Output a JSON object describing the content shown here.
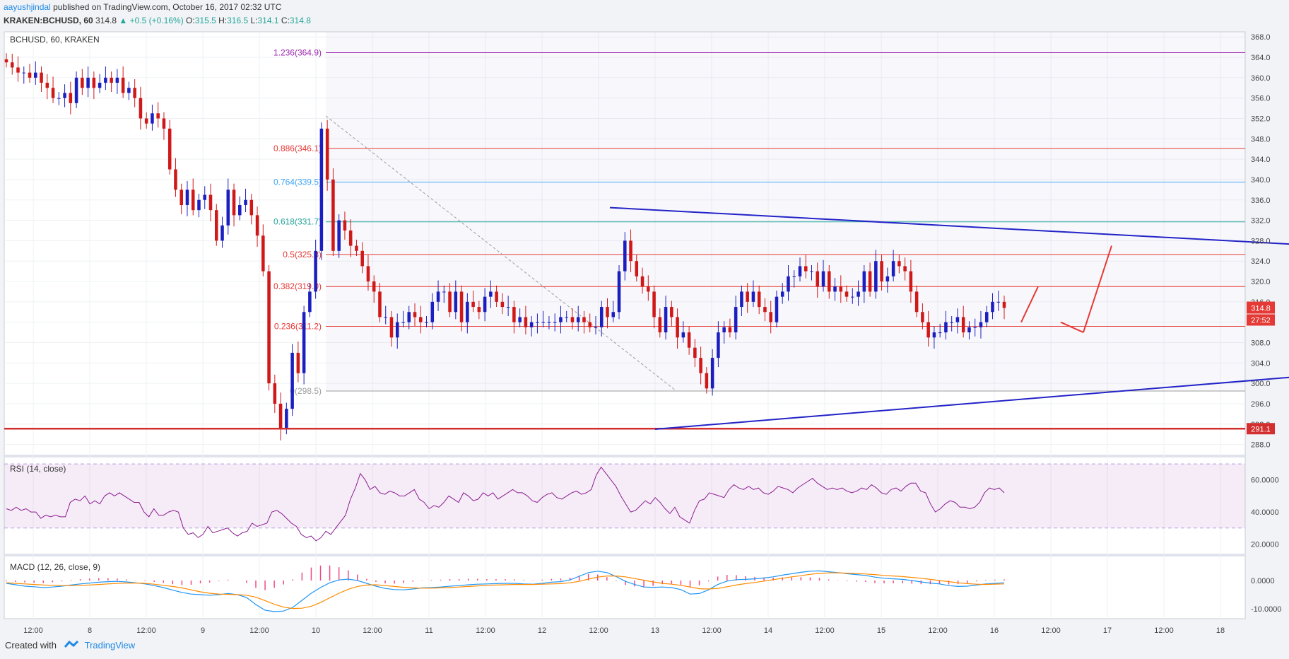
{
  "header": {
    "publisher": "aayushjindal",
    "published_text": "published on TradingView.com, October 16, 2017 02:32 UTC",
    "symbol": "KRAKEN:BCHUSD, 60",
    "last": "314.8",
    "change": "+0.5 (+0.16%)",
    "open_label": "O:",
    "open": "315.5",
    "high_label": "H:",
    "high": "316.5",
    "low_label": "L:",
    "low": "314.1",
    "close_label": "C:",
    "close": "314.8"
  },
  "footer": {
    "created_with": "Created with",
    "brand": "TradingView"
  },
  "colors": {
    "up": "#1c1fbf",
    "down": "#d01818",
    "trendline": "#2323c8",
    "rsi": "#8a1d8f",
    "macd": "#2196f3",
    "signal": "#ff8a00",
    "support": "#d32f2f"
  },
  "chart_data": [
    {
      "type": "candlestick",
      "title": "BCHUSD, 60, KRAKEN",
      "ylim": [
        286.0,
        369.0
      ],
      "y_ticks": [
        "368.0",
        "364.0",
        "360.0",
        "356.0",
        "352.0",
        "348.0",
        "344.0",
        "340.0",
        "336.0",
        "332.0",
        "328.0",
        "324.0",
        "320.0",
        "316.0",
        "312.0",
        "308.0",
        "304.0",
        "300.0",
        "296.0",
        "292.0",
        "288.0"
      ],
      "x_ticks": [
        "12:00",
        "8",
        "12:00",
        "9",
        "12:00",
        "10",
        "12:00",
        "11",
        "12:00",
        "12",
        "12:00",
        "13",
        "12:00",
        "14",
        "12:00",
        "15",
        "12:00",
        "16",
        "12:00",
        "17",
        "12:00",
        "18"
      ],
      "closes": [
        363,
        362,
        361,
        361,
        360,
        361,
        359,
        358,
        356,
        356,
        357,
        355,
        360,
        358,
        360,
        358,
        359,
        360,
        359,
        360,
        357,
        358,
        356,
        352,
        351,
        353,
        352,
        350,
        342,
        338,
        335,
        338,
        334,
        336,
        337,
        334,
        328,
        331,
        338,
        333,
        335,
        336,
        333,
        329,
        322,
        300,
        296,
        291,
        295,
        306,
        302,
        314,
        318,
        326,
        350,
        340,
        326,
        332,
        330,
        327,
        326,
        323,
        320,
        318,
        313,
        313,
        309,
        312,
        312,
        314,
        313,
        312,
        312,
        316,
        318,
        318,
        314,
        318,
        312,
        316,
        315,
        314,
        317,
        318,
        316,
        315,
        315,
        312,
        313,
        311,
        312,
        312,
        312,
        312,
        312,
        313,
        313,
        312,
        313,
        312,
        311,
        311,
        315,
        313,
        314,
        322,
        328,
        324,
        321,
        319,
        318,
        313,
        310,
        315,
        313,
        309,
        310,
        307,
        305,
        302,
        299,
        305,
        310,
        311,
        310,
        315,
        318,
        316,
        318,
        315,
        314,
        312,
        317,
        318,
        321,
        321,
        323,
        322,
        322,
        319,
        322,
        318,
        319,
        318,
        317,
        317,
        318,
        322,
        318,
        324,
        320,
        321,
        324,
        323,
        322,
        318,
        314,
        312,
        309,
        310,
        310,
        312,
        312,
        313,
        310,
        311,
        311,
        312,
        314,
        316,
        316,
        314.8
      ],
      "level_lines": [
        {
          "label": "1.236(364.9)",
          "value": 364.9,
          "color": "#9c27b0"
        },
        {
          "label": "0.886(346.1)",
          "value": 346.1,
          "color": "#e53935"
        },
        {
          "label": "0.764(339.5)",
          "value": 339.5,
          "color": "#42a5f5"
        },
        {
          "label": "0.618(331.7)",
          "value": 331.7,
          "color": "#26a69a"
        },
        {
          "label": "0.5(325.3)",
          "value": 325.3,
          "color": "#e53935"
        },
        {
          "label": "0.382(319.0)",
          "value": 319.0,
          "color": "#e53935"
        },
        {
          "label": "0.236(311.2)",
          "value": 311.2,
          "color": "#e53935"
        },
        {
          "label": "0(298.5)",
          "value": 298.5,
          "color": "#9e9e9e"
        }
      ],
      "support_line": {
        "value": 291.1,
        "label": "291.1"
      },
      "last_price_badge": "314.8",
      "timer_badge": "27:52",
      "trendlines": [
        {
          "from": [
            11,
            291.0
          ],
          "to": [
            27,
            305.5
          ]
        },
        {
          "from": [
            10.2,
            334.5
          ],
          "to": [
            27,
            324.5
          ]
        }
      ],
      "projection": [
        [
          0,
          312
        ],
        [
          0.3,
          319
        ],
        [
          0.7,
          312
        ],
        [
          1.1,
          310
        ],
        [
          1.6,
          327
        ]
      ]
    },
    {
      "type": "line",
      "title": "RSI (14, close)",
      "ylim": [
        14,
        74
      ],
      "bands": [
        30,
        70
      ],
      "y_ticks": [
        "60.0000",
        "40.0000",
        "20.0000"
      ],
      "values": [
        42,
        41,
        43,
        41,
        42,
        40,
        40,
        36,
        38,
        37,
        38,
        37,
        37,
        46,
        48,
        47,
        50,
        45,
        47,
        45,
        50,
        52,
        50,
        52,
        50,
        48,
        46,
        46,
        40,
        37,
        42,
        38,
        38,
        40,
        41,
        40,
        30,
        26,
        27,
        24,
        26,
        31,
        27,
        28,
        29,
        30,
        27,
        25,
        27,
        28,
        33,
        31,
        32,
        33,
        40,
        41,
        39,
        36,
        33,
        31,
        26,
        24,
        25,
        22,
        24,
        28,
        26,
        30,
        34,
        38,
        48,
        55,
        64,
        60,
        54,
        56,
        52,
        51,
        53,
        52,
        50,
        50,
        52,
        54,
        48,
        46,
        42,
        44,
        43,
        46,
        50,
        48,
        46,
        52,
        50,
        47,
        48,
        52,
        50,
        52,
        48,
        50,
        52,
        54,
        52,
        52,
        50,
        47,
        46,
        49,
        51,
        52,
        49,
        48,
        50,
        52,
        53,
        51,
        52,
        54,
        63,
        68,
        64,
        60,
        56,
        50,
        45,
        40,
        41,
        44,
        47,
        45,
        49,
        46,
        42,
        39,
        43,
        37,
        35,
        33,
        41,
        47,
        48,
        52,
        51,
        50,
        49,
        54,
        57,
        55,
        54,
        56,
        54,
        55,
        52,
        51,
        53,
        56,
        55,
        54,
        52,
        55,
        57,
        59,
        61,
        58,
        56,
        54,
        55,
        54,
        55,
        53,
        52,
        53,
        55,
        54,
        57,
        55,
        52,
        51,
        54,
        55,
        53,
        56,
        58,
        58,
        53,
        52,
        45,
        40,
        42,
        45,
        47,
        46,
        43,
        43,
        42,
        43,
        46,
        52,
        55,
        54,
        55,
        52
      ]
    },
    {
      "type": "line",
      "title": "MACD (12, 26, close, 9)",
      "ylim": [
        -13.5,
        8.5
      ],
      "y_ticks": [
        "0.0000",
        "-10.0000"
      ],
      "macd": [
        -1,
        -1.5,
        -2,
        -2.2,
        -2.5,
        -2.3,
        -2,
        -1.6,
        -1.2,
        -0.9,
        -0.6,
        -0.4,
        -0.3,
        -0.5,
        -0.8,
        -1.2,
        -1.8,
        -2.5,
        -3.4,
        -4.2,
        -4.8,
        -5,
        -5.2,
        -5,
        -4.6,
        -5,
        -6,
        -8.5,
        -10.5,
        -11,
        -10.8,
        -9.5,
        -7,
        -4.5,
        -2.5,
        -0.8,
        0.2,
        0.5,
        0,
        -1,
        -2,
        -2.8,
        -3.2,
        -3.3,
        -3,
        -2.6,
        -2.5,
        -2.3,
        -2,
        -1.8,
        -1.5,
        -1.3,
        -1.2,
        -1.1,
        -1.0,
        -1.0,
        -1.2,
        -1.3,
        -1.0,
        -0.6,
        -0.4,
        0.2,
        1.5,
        2.8,
        3.3,
        2.8,
        1.4,
        -0.3,
        -1.4,
        -2.3,
        -2.4,
        -2.3,
        -2.5,
        -3.2,
        -4.8,
        -4.6,
        -3.3,
        -1.4,
        -0.2,
        0.3,
        0.4,
        0.6,
        0.9,
        1.3,
        1.9,
        2.4,
        2.9,
        3.3,
        3.4,
        3.1,
        2.8,
        2.4,
        2.1,
        1.8,
        1.2,
        0.8,
        0.6,
        0.4,
        0,
        -0.5,
        -0.9,
        -1.2,
        -1.8,
        -2.1,
        -2.0,
        -1.6,
        -1.2,
        -1.0,
        -0.8
      ],
      "signal": [
        -0.8,
        -1,
        -1.2,
        -1.4,
        -1.6,
        -1.7,
        -1.8,
        -1.8,
        -1.7,
        -1.6,
        -1.4,
        -1.2,
        -1.0,
        -0.9,
        -0.9,
        -1.0,
        -1.3,
        -1.7,
        -2.1,
        -2.6,
        -3.3,
        -4.0,
        -4.5,
        -4.8,
        -4.9,
        -5.0,
        -5.2,
        -5.9,
        -7.1,
        -8.4,
        -9.4,
        -9.9,
        -9.8,
        -9.1,
        -7.8,
        -6.1,
        -4.5,
        -3.1,
        -2.1,
        -1.6,
        -1.5,
        -1.8,
        -2.1,
        -2.4,
        -2.6,
        -2.7,
        -2.7,
        -2.6,
        -2.5,
        -2.3,
        -2.1,
        -1.9,
        -1.7,
        -1.6,
        -1.5,
        -1.4,
        -1.4,
        -1.4,
        -1.3,
        -1.2,
        -1.1,
        -0.8,
        -0.3,
        0.5,
        1.2,
        1.6,
        1.6,
        1.3,
        0.7,
        0.1,
        -0.5,
        -1.0,
        -1.3,
        -1.7,
        -2.3,
        -2.9,
        -3.0,
        -2.8,
        -2.2,
        -1.6,
        -1.1,
        -0.7,
        -0.2,
        0.3,
        0.8,
        1.3,
        1.7,
        2.2,
        2.5,
        2.7,
        2.7,
        2.6,
        2.5,
        2.3,
        2.1,
        1.8,
        1.6,
        1.4,
        1.1,
        0.8,
        0.4,
        0,
        -0.4,
        -0.8,
        -1.1,
        -1.3,
        -1.4,
        -1.3,
        -1.2
      ],
      "histogram": [
        -0.3,
        -0.5,
        -0.7,
        -0.8,
        -0.9,
        -0.6,
        -0.3,
        0.2,
        0.5,
        0.7,
        0.8,
        0.8,
        0.7,
        0.4,
        0.1,
        -0.2,
        -0.5,
        -0.8,
        -1.3,
        -1.6,
        -1.5,
        -1.0,
        -0.7,
        -0.2,
        0.3,
        0,
        -0.8,
        -2.6,
        -3.4,
        -2.6,
        -1.4,
        0.4,
        2.8,
        4.6,
        5.3,
        5.3,
        4.7,
        3.6,
        2.1,
        0.6,
        -0.5,
        -1.0,
        -1.1,
        -0.9,
        -0.4,
        0.1,
        0.2,
        0.3,
        0.5,
        0.5,
        0.6,
        0.6,
        0.5,
        0.5,
        0.5,
        0.4,
        0.2,
        0.1,
        0.3,
        0.6,
        0.7,
        1.0,
        1.8,
        2.3,
        2.1,
        1.2,
        -0.2,
        -1.6,
        -2.1,
        -2.4,
        -1.9,
        -1.3,
        -1.2,
        -1.5,
        -2.5,
        -1.7,
        -0.3,
        1.4,
        2.0,
        1.9,
        1.5,
        1.3,
        1.1,
        1.0,
        1.1,
        1.1,
        1.2,
        1.1,
        0.9,
        0.4,
        0.1,
        -0.2,
        -0.4,
        -0.5,
        -0.9,
        -1.0,
        -1.0,
        -1.0,
        -1.1,
        -1.3,
        -1.3,
        -1.2,
        -1.4,
        -1.3,
        -0.9,
        -0.3,
        0.2,
        0.3,
        0.4
      ]
    }
  ]
}
